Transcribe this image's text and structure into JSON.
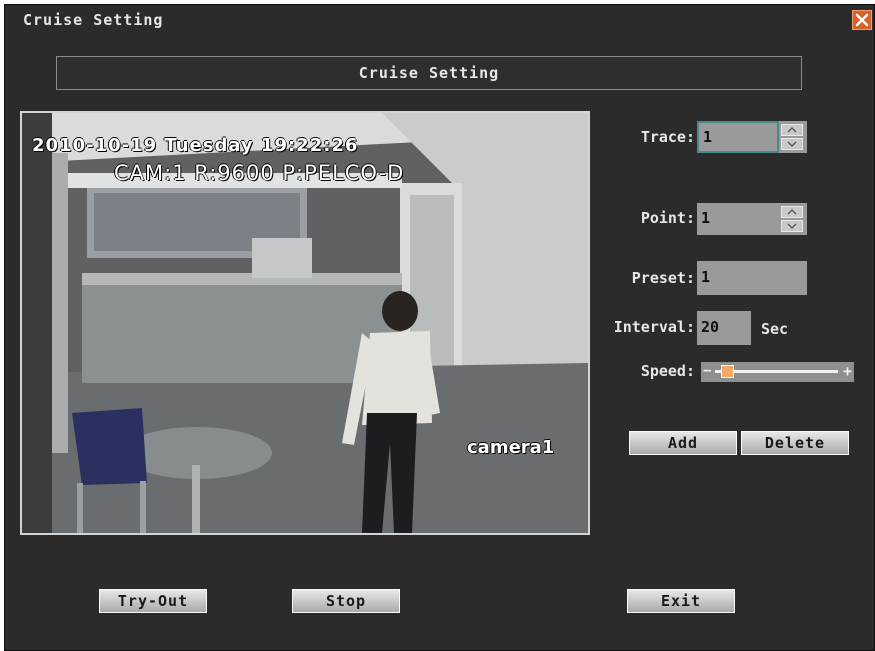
{
  "window": {
    "title": "Cruise Setting"
  },
  "header": {
    "title": "Cruise Setting"
  },
  "video": {
    "osd_date": "2010-10-19 Tuesday 19:22:26",
    "osd_camera_info": "CAM:1  R:9600 P:PELCO-D",
    "osd_camera_name": "camera1"
  },
  "form": {
    "trace_label": "Trace:",
    "trace_value": "1",
    "point_label": "Point:",
    "point_value": "1",
    "preset_label": "Preset:",
    "preset_value": "1",
    "interval_label": "Interval:",
    "interval_value": "20",
    "interval_unit": "Sec",
    "speed_label": "Speed:",
    "speed_level": 0.05,
    "speed_minus": "−",
    "speed_plus": "+"
  },
  "buttons": {
    "add": "Add",
    "delete": "Delete",
    "try_out": "Try-Out",
    "stop": "Stop",
    "exit": "Exit"
  },
  "colors": {
    "window_bg": "#2b2b2b",
    "field_bg": "#9a9a9a",
    "focus_border": "#4a8a86",
    "close_button": "#d9602a",
    "slider_thumb": "#f1a86a"
  },
  "icons": {
    "close": "close-x-icon",
    "spin_up": "caret-up-icon",
    "spin_down": "caret-down-icon"
  }
}
